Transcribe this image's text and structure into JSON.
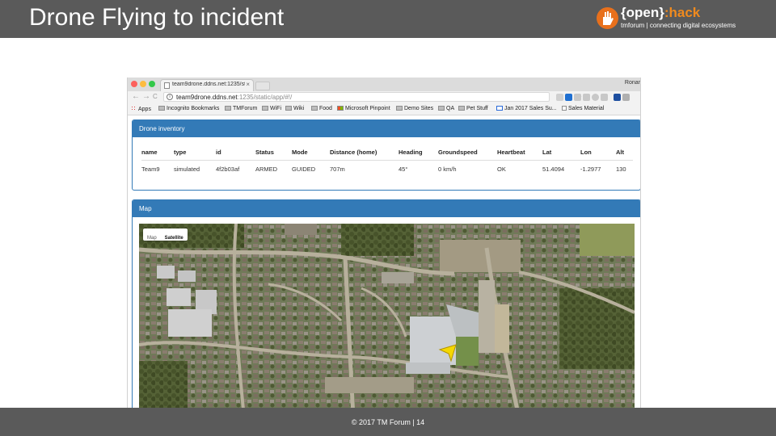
{
  "slide": {
    "title": "Drone Flying to incident",
    "footer": "© 2017 TM Forum   |   14"
  },
  "logo": {
    "open": "{open}",
    "colon": ":",
    "hack": "hack",
    "tagline": "tmforum | connecting digital ecosystems"
  },
  "browser": {
    "tab_title": "team9drone.ddns.net:1235/st",
    "tab_close": "×",
    "profile": "Ronar",
    "back": "←",
    "forward": "→",
    "reload": "C",
    "url_host": "team9drone.ddns.net",
    "url_path": ":1235/static/app/#!/",
    "star": "☆",
    "bookmarks": [
      "Apps",
      "Incognito Bookmarks",
      "TMForum",
      "WiFi",
      "Wiki",
      "Food",
      "Microsoft Pinpoint",
      "Demo Sites",
      "QA",
      "Pet Stuff",
      "Jan 2017 Sales Su...",
      "Sales Material"
    ]
  },
  "inventory": {
    "title": "Drone inventory",
    "columns": [
      "name",
      "type",
      "id",
      "Status",
      "Mode",
      "Distance (home)",
      "Heading",
      "Groundspeed",
      "Heartbeat",
      "Lat",
      "Lon",
      "Alt"
    ],
    "row": [
      "Team9",
      "simulated",
      "4f2b03af",
      "ARMED",
      "GUIDED",
      "707m",
      "45°",
      "0 km/h",
      "OK",
      "51.4094",
      "-1.2977",
      "130"
    ]
  },
  "map": {
    "title": "Map",
    "toggle_map": "Map",
    "toggle_satellite": "Satellite",
    "selected": "Satellite",
    "drone_marker_color": "#f5d800"
  }
}
